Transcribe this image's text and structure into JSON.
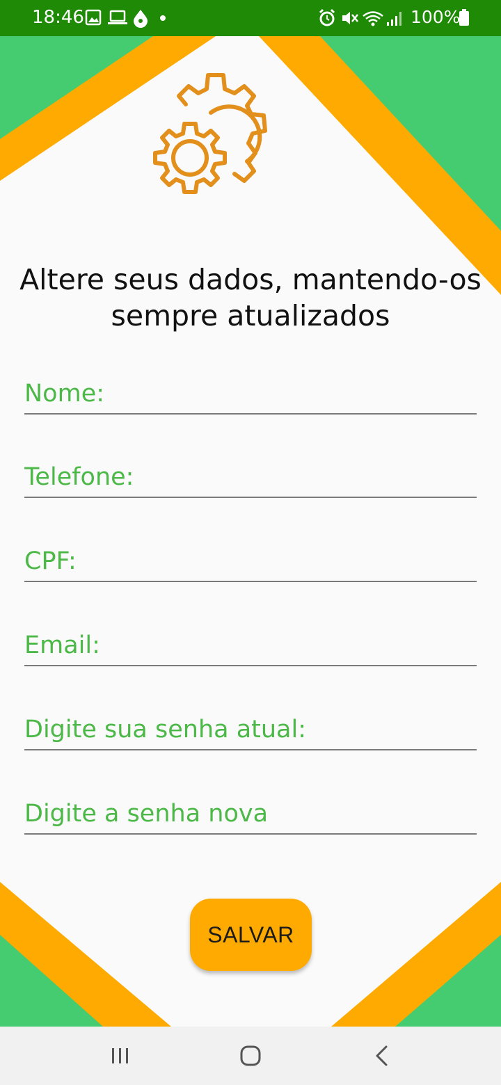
{
  "status_bar": {
    "time": "18:46",
    "battery": "100%",
    "left_icons": [
      "image-icon",
      "laptop-icon",
      "drop-icon",
      "dot-icon"
    ],
    "right_icons": [
      "alarm-icon",
      "mute-icon",
      "wifi-icon",
      "signal-icon",
      "battery-icon"
    ]
  },
  "header": {
    "icon": "settings-gears-icon",
    "title": "Altere seus dados, mantendo-os sempre atualizados"
  },
  "form": {
    "fields": [
      {
        "placeholder": "Nome:",
        "value": ""
      },
      {
        "placeholder": "Telefone:",
        "value": ""
      },
      {
        "placeholder": "CPF:",
        "value": ""
      },
      {
        "placeholder": "Email:",
        "value": ""
      },
      {
        "placeholder": "Digite sua senha atual:",
        "value": ""
      },
      {
        "placeholder": "Digite a senha nova",
        "value": ""
      }
    ],
    "save_label": "SALVAR"
  },
  "nav_bar": {
    "buttons": [
      "recent-apps-icon",
      "home-icon",
      "back-icon"
    ]
  },
  "colors": {
    "status_bar": "#1e8a05",
    "green": "#46cc70",
    "orange": "#ffaa00",
    "gear": "#e28f1c",
    "placeholder": "#4cb848",
    "background": "#fafafa"
  }
}
